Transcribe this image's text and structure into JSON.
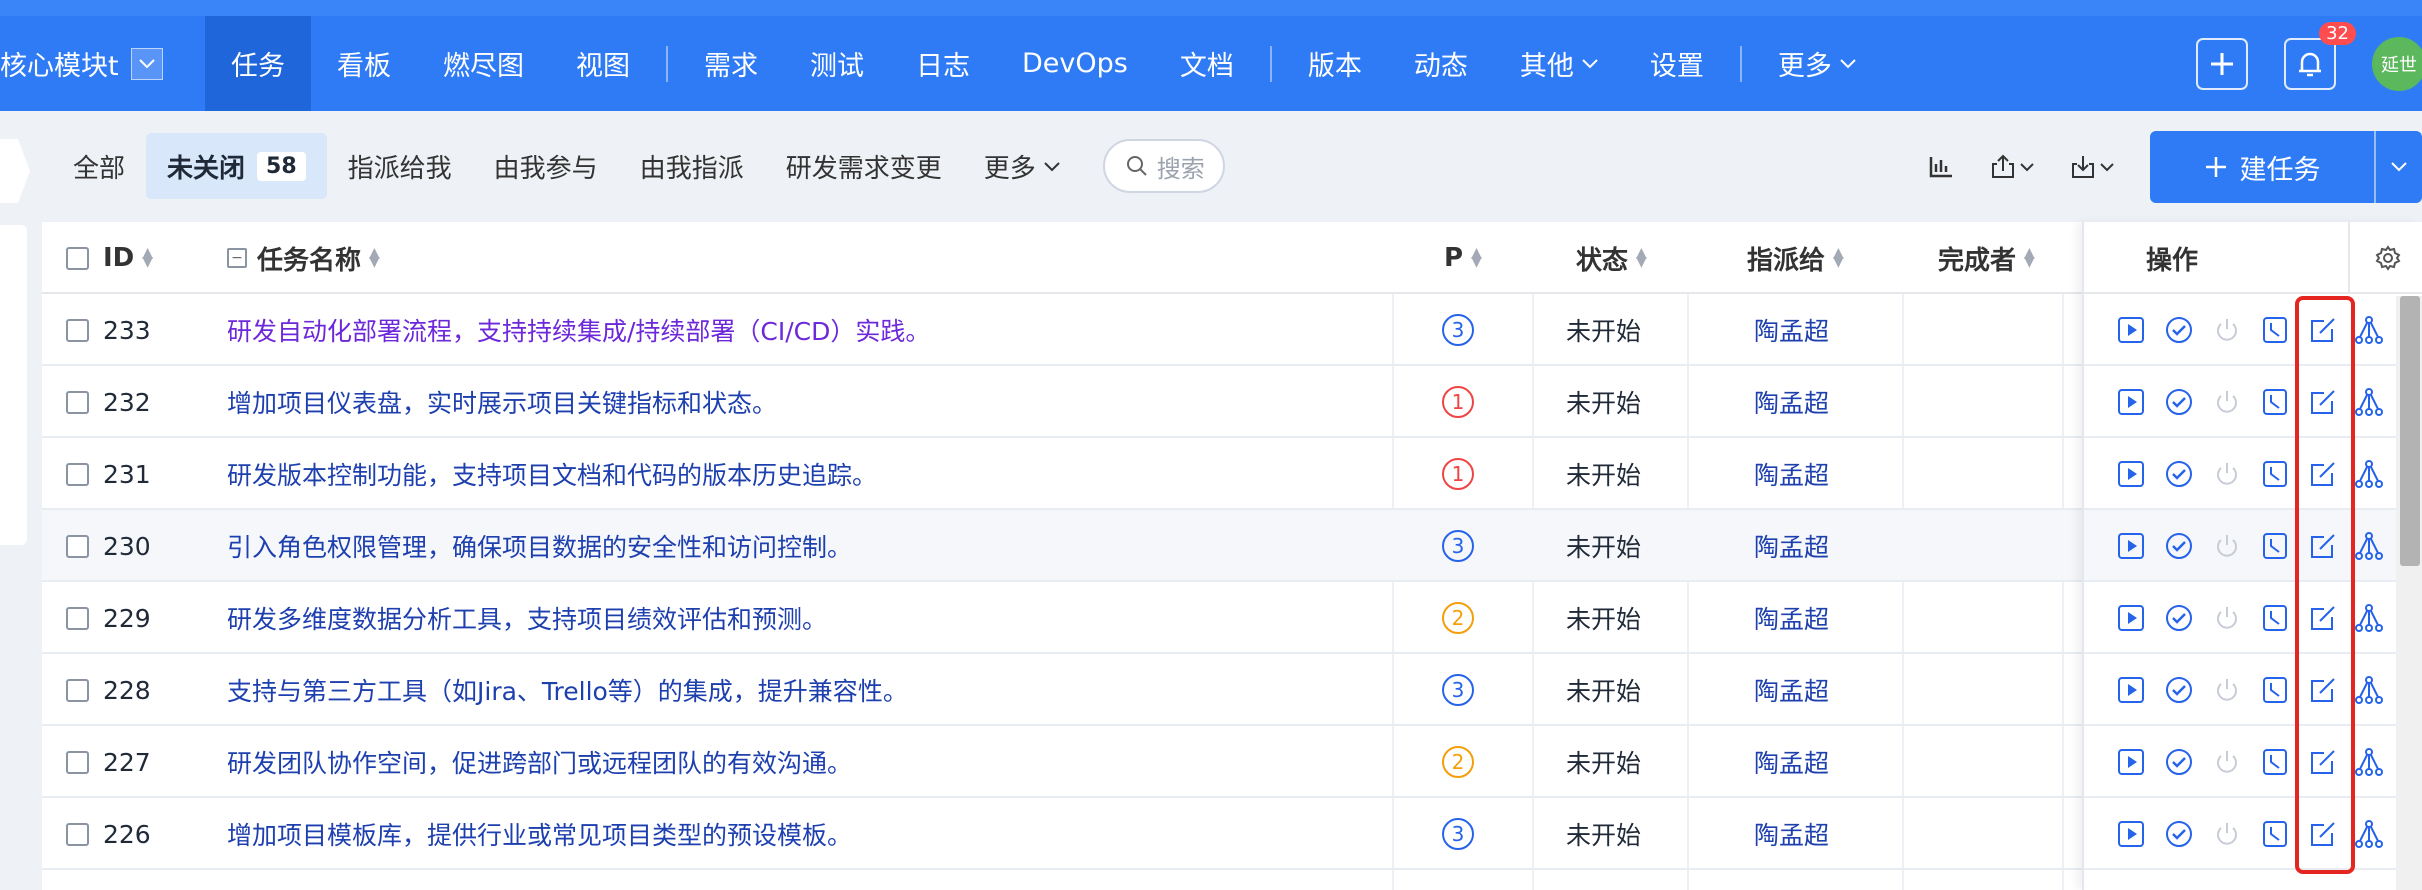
{
  "project": {
    "name": "核心模块t"
  },
  "nav": {
    "items": [
      {
        "label": "任务",
        "active": true,
        "caret": false,
        "sep_after": false
      },
      {
        "label": "看板",
        "active": false,
        "caret": false,
        "sep_after": false
      },
      {
        "label": "燃尽图",
        "active": false,
        "caret": false,
        "sep_after": false
      },
      {
        "label": "视图",
        "active": false,
        "caret": false,
        "sep_after": true
      },
      {
        "label": "需求",
        "active": false,
        "caret": false,
        "sep_after": false
      },
      {
        "label": "测试",
        "active": false,
        "caret": false,
        "sep_after": false
      },
      {
        "label": "日志",
        "active": false,
        "caret": false,
        "sep_after": false
      },
      {
        "label": "DevOps",
        "active": false,
        "caret": false,
        "sep_after": false
      },
      {
        "label": "文档",
        "active": false,
        "caret": false,
        "sep_after": true
      },
      {
        "label": "版本",
        "active": false,
        "caret": false,
        "sep_after": false
      },
      {
        "label": "动态",
        "active": false,
        "caret": false,
        "sep_after": false
      },
      {
        "label": "其他",
        "active": false,
        "caret": true,
        "sep_after": false
      },
      {
        "label": "设置",
        "active": false,
        "caret": false,
        "sep_after": true
      },
      {
        "label": "更多",
        "active": false,
        "caret": true,
        "sep_after": false
      }
    ]
  },
  "topright": {
    "notification_count": "32",
    "avatar_text": "延世"
  },
  "filters": {
    "items": [
      {
        "label": "全部",
        "active": false
      },
      {
        "label": "未关闭",
        "active": true,
        "count": "58"
      },
      {
        "label": "指派给我",
        "active": false
      },
      {
        "label": "由我参与",
        "active": false
      },
      {
        "label": "由我指派",
        "active": false
      },
      {
        "label": "研发需求变更",
        "active": false
      },
      {
        "label": "更多",
        "active": false,
        "caret": true
      }
    ],
    "search_placeholder": "搜索"
  },
  "toolbar": {
    "create_label": "建任务"
  },
  "table": {
    "headers": {
      "id": "ID",
      "name": "任务名称",
      "pri": "P",
      "status": "状态",
      "assign": "指派给",
      "finisher": "完成者",
      "ops": "操作"
    },
    "rows": [
      {
        "id": "233",
        "name": "研发自动化部署流程，支持持续集成/持续部署（CI/CD）实践。",
        "pri": "3",
        "status": "未开始",
        "assign": "陶孟超",
        "visited": true
      },
      {
        "id": "232",
        "name": "增加项目仪表盘，实时展示项目关键指标和状态。",
        "pri": "1",
        "status": "未开始",
        "assign": "陶孟超",
        "visited": false
      },
      {
        "id": "231",
        "name": "研发版本控制功能，支持项目文档和代码的版本历史追踪。",
        "pri": "1",
        "status": "未开始",
        "assign": "陶孟超",
        "visited": false
      },
      {
        "id": "230",
        "name": "引入角色权限管理，确保项目数据的安全性和访问控制。",
        "pri": "3",
        "status": "未开始",
        "assign": "陶孟超",
        "visited": false
      },
      {
        "id": "229",
        "name": "研发多维度数据分析工具，支持项目绩效评估和预测。",
        "pri": "2",
        "status": "未开始",
        "assign": "陶孟超",
        "visited": false
      },
      {
        "id": "228",
        "name": "支持与第三方工具（如Jira、Trello等）的集成，提升兼容性。",
        "pri": "3",
        "status": "未开始",
        "assign": "陶孟超",
        "visited": false
      },
      {
        "id": "227",
        "name": "研发团队协作空间，促进跨部门或远程团队的有效沟通。",
        "pri": "2",
        "status": "未开始",
        "assign": "陶孟超",
        "visited": false
      },
      {
        "id": "226",
        "name": "增加项目模板库，提供行业或常见项目类型的预设模板。",
        "pri": "3",
        "status": "未开始",
        "assign": "陶孟超",
        "visited": false
      }
    ]
  },
  "colors": {
    "primary": "#2f7bf5",
    "highlight": "#e5251f",
    "link": "#1e40af"
  }
}
